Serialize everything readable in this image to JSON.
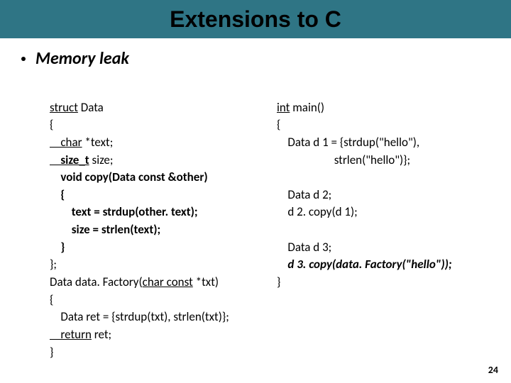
{
  "title": "Extensions to C",
  "bullet": "Memory leak",
  "left": {
    "l01a": "struct",
    "l01b": " Data",
    "l02": "{",
    "l03a": "    char",
    "l03b": " *text;",
    "l04a": "    size_t",
    "l04b": " size;",
    "l05": "    void copy(Data const &other)",
    "l06": "    {",
    "l07": "        text = strdup(other. text);",
    "l08": "        size = strlen(text);",
    "l09": "    }",
    "l10": "};",
    "l11a": "Data data. Factory(",
    "l11b": "char const",
    "l11c": " *txt)",
    "l12": "{",
    "l13": "    Data ret = {strdup(txt), strlen(txt)};",
    "l14a": "    return",
    "l14b": " ret;",
    "l15": "}"
  },
  "right": {
    "l01a": "int",
    "l01b": " main()",
    "l02": "{",
    "l03": "    Data d 1 = {strdup(\"hello\"),",
    "l04": "                     strlen(\"hello\")};",
    "l05": " ",
    "l06": "    Data d 2;",
    "l07": "    d 2. copy(d 1);",
    "l08": " ",
    "l09": "    Data d 3;",
    "l10": "    d 3. copy(data. Factory(\"hello\"));",
    "l11": "}"
  },
  "page": "24"
}
